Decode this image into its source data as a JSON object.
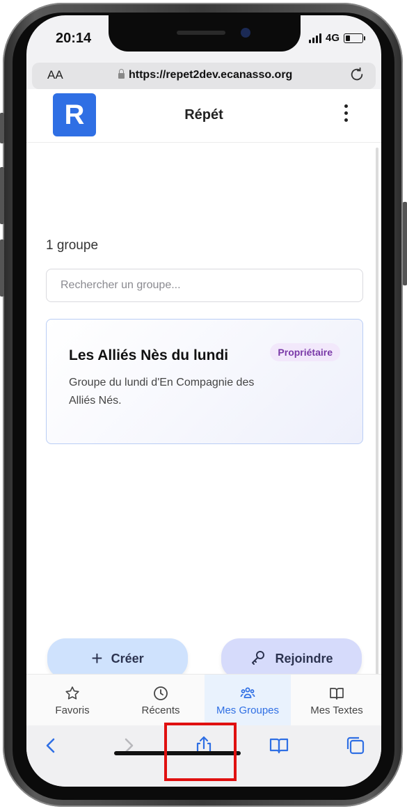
{
  "status_bar": {
    "time": "20:14",
    "network": "4G"
  },
  "browser": {
    "aa_label": "AA",
    "url": "https://repet2dev.ecanasso.org"
  },
  "header": {
    "logo_letter": "R",
    "title": "Répét"
  },
  "main": {
    "group_count": "1 groupe",
    "search_placeholder": "Rechercher un groupe...",
    "groups": [
      {
        "name": "Les Alliés Nès du lundi",
        "role_badge": "Propriétaire",
        "description": "Groupe du lundi d'En Compagnie des Alliés Nés."
      }
    ],
    "create_label": "Créer",
    "join_label": "Rejoindre"
  },
  "tabbar": {
    "tabs": [
      {
        "label": "Favoris",
        "icon": "star-icon",
        "active": false
      },
      {
        "label": "Récents",
        "icon": "clock-icon",
        "active": false
      },
      {
        "label": "Mes Groupes",
        "icon": "users-icon",
        "active": true
      },
      {
        "label": "Mes Textes",
        "icon": "book-icon",
        "active": false
      }
    ]
  },
  "colors": {
    "accent": "#2f6fe4",
    "badge_text": "#7a3aa8",
    "badge_bg": "#f2e8fb",
    "highlight": "#e01010"
  }
}
